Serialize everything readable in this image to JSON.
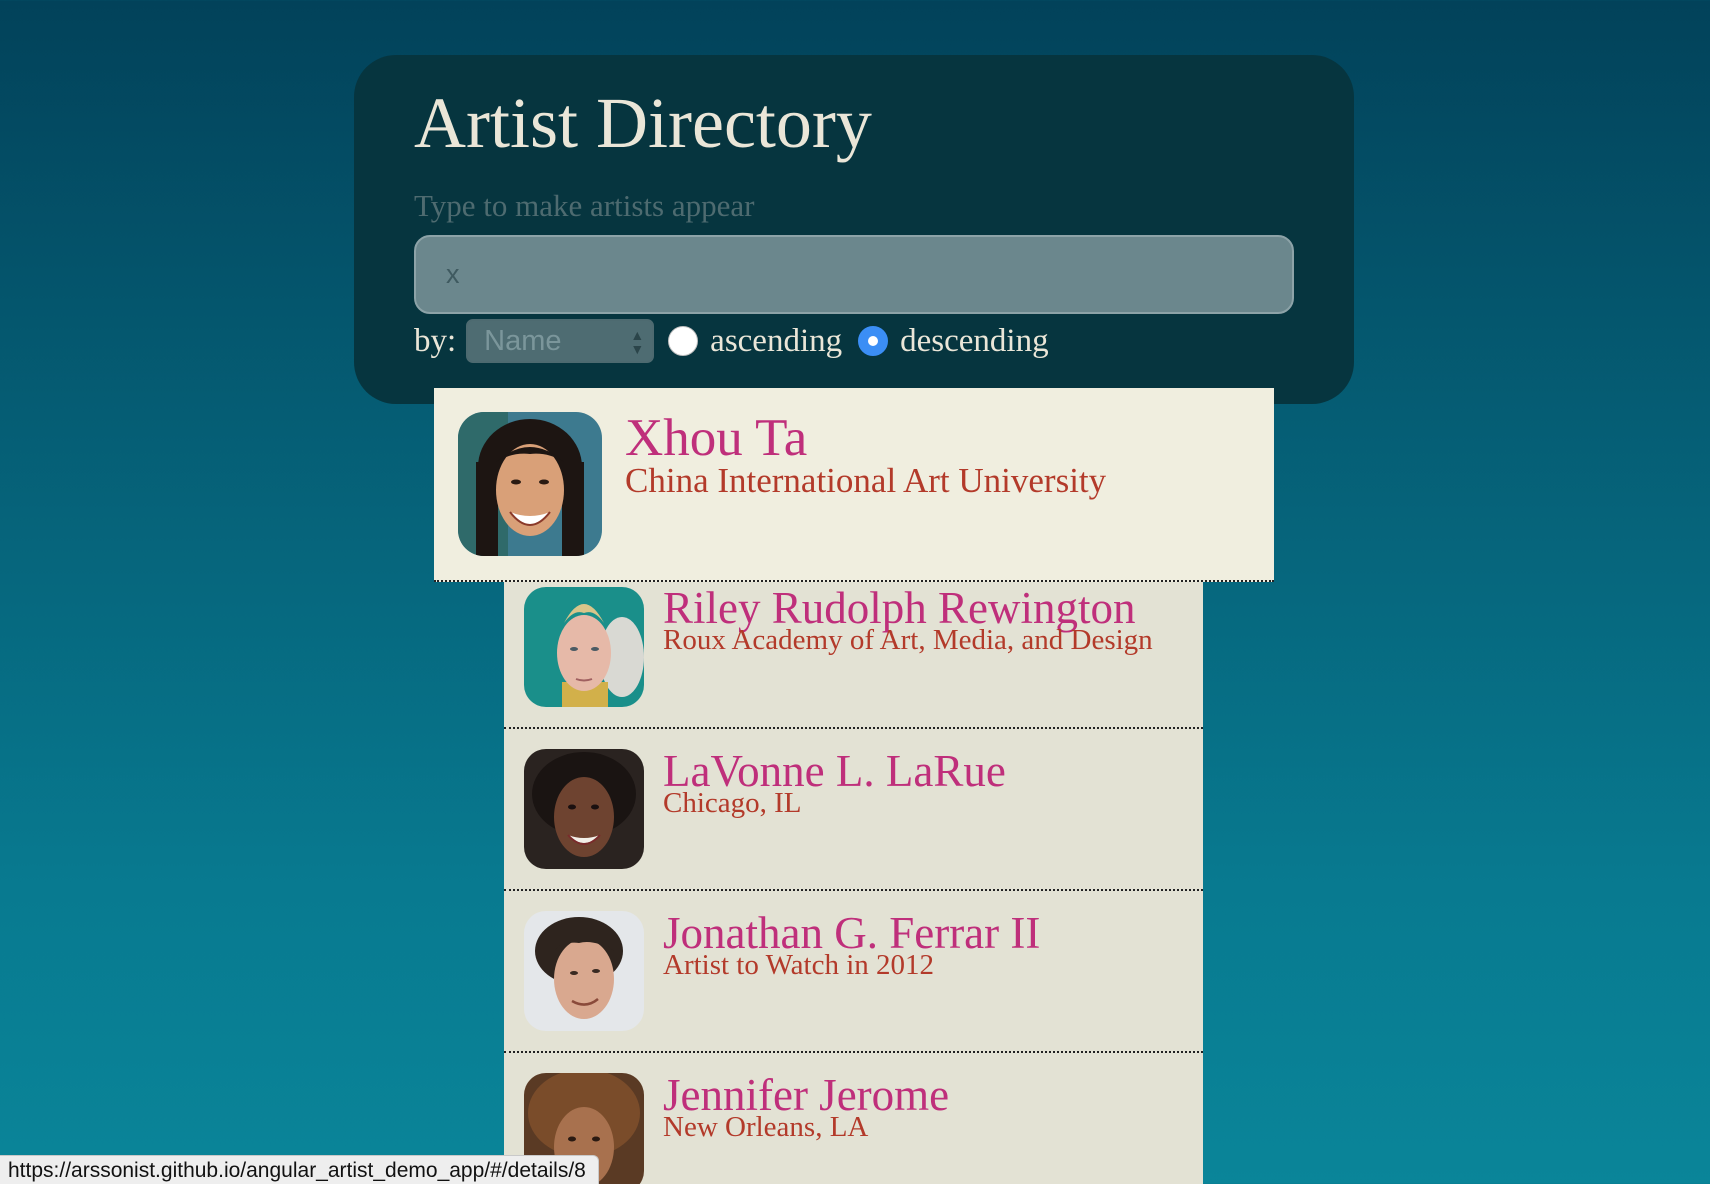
{
  "header": {
    "title": "Artist Directory",
    "hint": "Type to make artists appear"
  },
  "search": {
    "value": "x",
    "placeholder": ""
  },
  "sort": {
    "by_label": "by:",
    "selected": "Name",
    "ascending_label": "ascending",
    "descending_label": "descending",
    "order": "descending"
  },
  "artists": [
    {
      "name": "Xhou Ta",
      "detail": "China International Art University",
      "avatar_icon": "portrait-photo"
    },
    {
      "name": "Riley Rudolph Rewington",
      "detail": "Roux Academy of Art, Media, and Design",
      "avatar_icon": "portrait-photo"
    },
    {
      "name": "LaVonne L. LaRue",
      "detail": "Chicago, IL",
      "avatar_icon": "portrait-photo"
    },
    {
      "name": "Jonathan G. Ferrar II",
      "detail": "Artist to Watch in 2012",
      "avatar_icon": "portrait-photo"
    },
    {
      "name": "Jennifer Jerome",
      "detail": "New Orleans, LA",
      "avatar_icon": "portrait-photo"
    }
  ],
  "status_bar": {
    "url": "https://arssonist.github.io/angular_artist_demo_app/#/details/8"
  },
  "colors": {
    "panel": "#06353f",
    "name": "#bf2f7b",
    "detail": "#b33a2a",
    "list_bg": "#e3e2d4",
    "featured_bg": "#f0eedf",
    "radio_checked": "#3b8ef5"
  }
}
